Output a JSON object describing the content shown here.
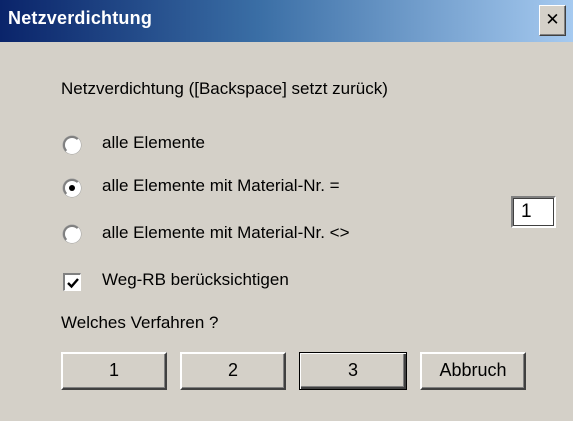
{
  "window": {
    "title": "Netzverdichtung",
    "close_glyph": "✕",
    "close_icon": "close-icon"
  },
  "heading": "Netzverdichtung ([Backspace] setzt zurück)",
  "options": [
    {
      "label": "alle Elemente",
      "selected": false
    },
    {
      "label": "alle Elemente mit Material-Nr. =",
      "selected": true
    },
    {
      "label": "alle Elemente mit Material-Nr. <>",
      "selected": false
    }
  ],
  "material_number": "1",
  "checkbox": {
    "label": "Weg-RB berücksichtigen",
    "checked": true
  },
  "question": "Welches Verfahren ?",
  "buttons": {
    "b1": "1",
    "b2": "2",
    "b3": "3",
    "cancel": "Abbruch"
  },
  "colors": {
    "title_start": "#0a246a",
    "title_end": "#a6caf0",
    "face": "#d4d0c8"
  }
}
